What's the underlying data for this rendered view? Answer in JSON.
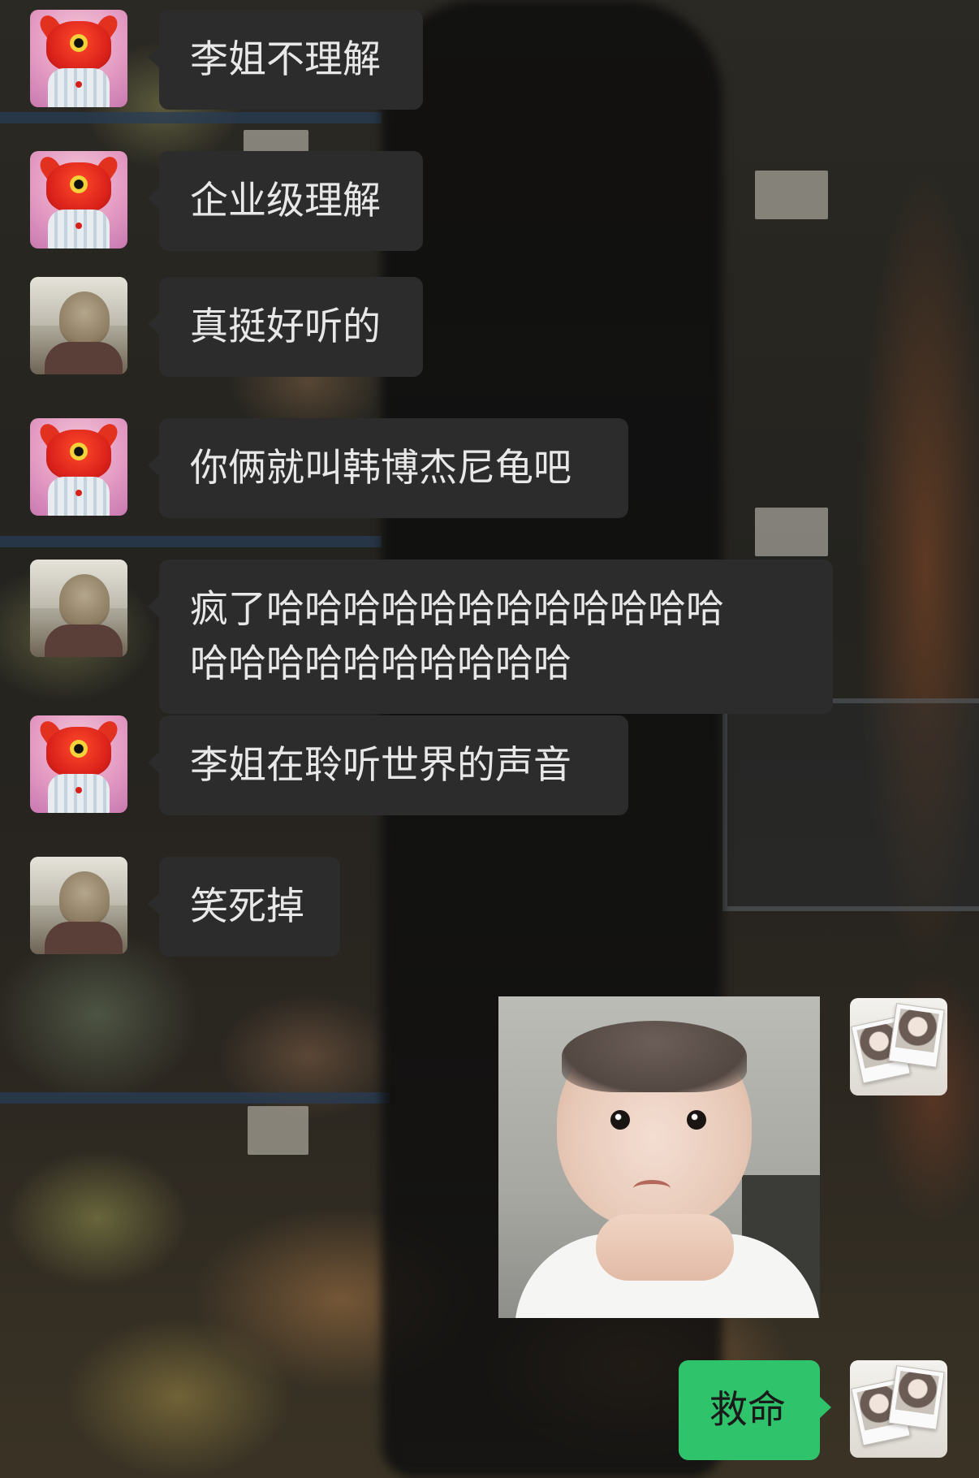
{
  "messages": [
    {
      "side": "left",
      "sender": "monster",
      "text": "李姐不理解"
    },
    {
      "side": "left",
      "sender": "monster",
      "text": "企业级理解"
    },
    {
      "side": "left",
      "sender": "photo",
      "text": "真挺好听的"
    },
    {
      "side": "left",
      "sender": "monster",
      "text": "你俩就叫韩博杰尼龟吧"
    },
    {
      "side": "left",
      "sender": "photo",
      "text": "疯了哈哈哈哈哈哈哈哈哈哈哈哈\n哈哈哈哈哈哈哈哈哈哈"
    },
    {
      "side": "left",
      "sender": "monster",
      "text": "李姐在聆听世界的声音"
    },
    {
      "side": "left",
      "sender": "photo",
      "text": "笑死掉"
    },
    {
      "side": "right",
      "sender": "me",
      "type": "image"
    },
    {
      "side": "right",
      "sender": "me",
      "text": "救命"
    }
  ],
  "colors": {
    "incoming_bubble": "#2c2c2c",
    "outgoing_bubble": "#2fc36b",
    "incoming_text": "#e8e8e8",
    "outgoing_text": "#1a1a1a"
  },
  "icons": {
    "monster": "red-monster-avatar-icon",
    "photo": "grey-haired-person-avatar-icon",
    "me": "polaroid-photos-avatar-icon"
  }
}
